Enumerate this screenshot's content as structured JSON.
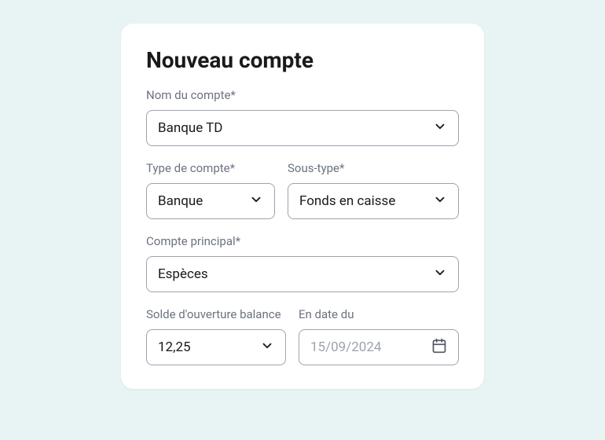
{
  "title": "Nouveau compte",
  "fields": {
    "accountName": {
      "label": "Nom du compte*",
      "value": "Banque TD"
    },
    "accountType": {
      "label": "Type de compte*",
      "value": "Banque"
    },
    "subType": {
      "label": "Sous-type*",
      "value": "Fonds en caisse"
    },
    "parentAccount": {
      "label": "Compte principal*",
      "value": "Espèces"
    },
    "openingBalance": {
      "label": "Solde d'ouverture balance",
      "value": "12,25"
    },
    "asOfDate": {
      "label": "En date du",
      "value": "15/09/2024"
    }
  }
}
